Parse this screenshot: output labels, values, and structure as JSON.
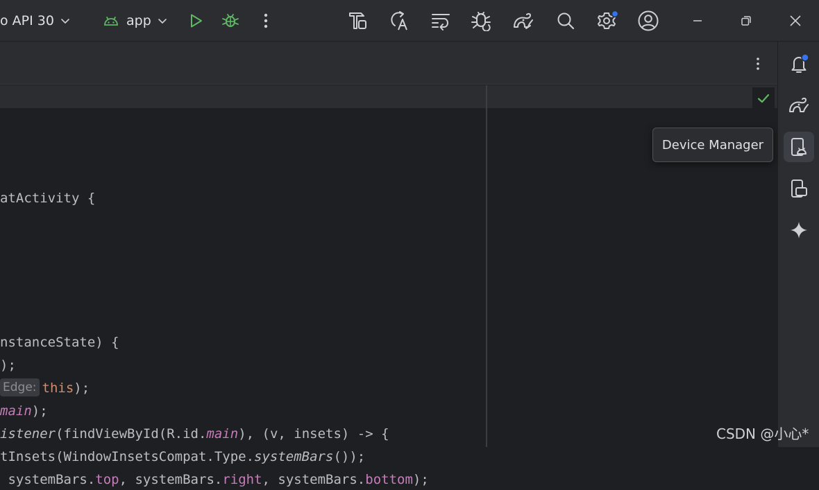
{
  "toolbar": {
    "device_label": "o API 30",
    "run_config_label": "app",
    "icon_names": [
      "chevron-down-icon",
      "android-icon",
      "run-icon",
      "debug-icon",
      "more-vertical-icon",
      "build-icon",
      "translate-icon",
      "sync-icon",
      "profiler-icon",
      "gradle-icon",
      "search-icon",
      "settings-icon",
      "account-icon",
      "minimize-icon",
      "restore-icon",
      "close-icon"
    ]
  },
  "sidebar": {
    "items": [
      "notifications-icon",
      "gradle-icon",
      "device-manager-icon",
      "running-devices-icon",
      "gemini-icon"
    ],
    "active_item": "device-manager-icon"
  },
  "tooltip": {
    "text": "Device Manager"
  },
  "editor": {
    "lines": [
      [
        {
          "t": "atActivity {",
          "c": ""
        }
      ],
      [
        {
          "t": "nstanceState) {",
          "c": ""
        }
      ],
      [
        {
          "t": ");",
          "c": ""
        }
      ],
      [
        {
          "t": "Edge:",
          "c": "hint"
        },
        {
          "t": "this",
          "c": "kw"
        },
        {
          "t": ");",
          "c": ""
        }
      ],
      [
        {
          "t": "main",
          "c": "fi"
        },
        {
          "t": ");",
          "c": ""
        }
      ],
      [
        {
          "t": "istener",
          "c": "it"
        },
        {
          "t": "(findViewById(R.id.",
          "c": ""
        },
        {
          "t": "main",
          "c": "fi"
        },
        {
          "t": "), (v, insets) -> {",
          "c": ""
        }
      ],
      [
        {
          "t": "tInsets(WindowInsetsCompat.Type.",
          "c": ""
        },
        {
          "t": "systemBars",
          "c": "it"
        },
        {
          "t": "());",
          "c": ""
        }
      ],
      [
        {
          "t": " systemBars.",
          "c": ""
        },
        {
          "t": "top",
          "c": "fld"
        },
        {
          "t": ", systemBars.",
          "c": ""
        },
        {
          "t": "right",
          "c": "fld"
        },
        {
          "t": ", systemBars.",
          "c": ""
        },
        {
          "t": "bottom",
          "c": "fld"
        },
        {
          "t": ");",
          "c": ""
        }
      ]
    ]
  },
  "watermark": "CSDN @小心*",
  "colors": {
    "background": "#1e1f22",
    "panel": "#2b2d30",
    "keyword": "#cf8e6d",
    "field": "#c77dbb",
    "run_green": "#5fb865",
    "notification_dot": "#3574f0"
  }
}
